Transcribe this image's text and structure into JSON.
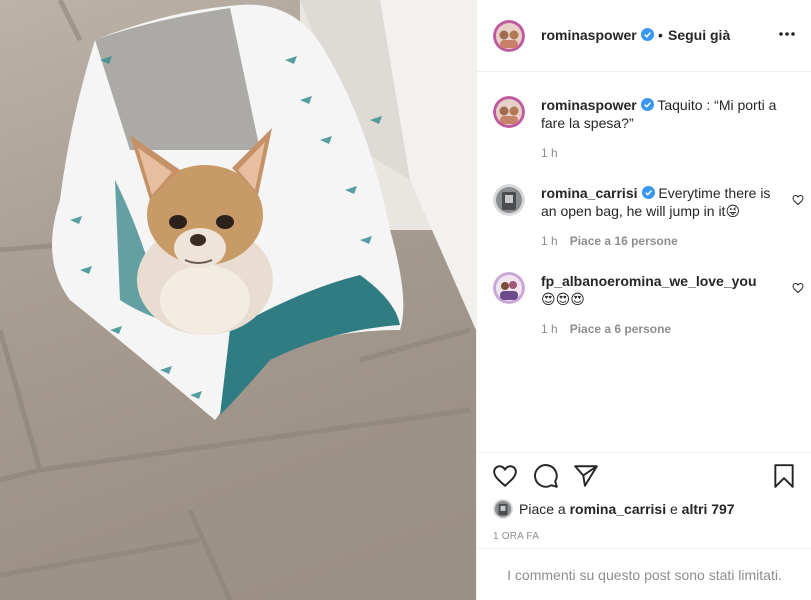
{
  "post": {
    "author": "rominaspower",
    "follow_label": "Segui già",
    "follow_separator": "•",
    "caption_author": "rominaspower",
    "caption_text": "Taquito : “Mi porti a fare la spesa?”",
    "caption_time": "1 h"
  },
  "comments": [
    {
      "username": "romina_carrisi",
      "verified": true,
      "text": "Everytime there is an open bag, he will jump in it😜",
      "time": "1 h",
      "likes": "Piace a 16 persone"
    },
    {
      "username": "fp_albanoeromina_we_love_you",
      "verified": false,
      "text": "😍😍😍",
      "time": "1 h",
      "likes": "Piace a 6 persone"
    }
  ],
  "likes_line": {
    "prefix": "Piace a",
    "user": "romina_carrisi",
    "connector": "e",
    "others": "altri 797"
  },
  "timestamp": "1 ORA FA",
  "comments_limited": "I commenti su questo post sono stati limitati.",
  "colors": {
    "verified": "#3897f0",
    "text": "#262626",
    "muted": "#8e8e8e",
    "divider": "#efefef"
  },
  "icons": {
    "more": "more-horizontal-icon",
    "like": "heart-icon",
    "comment": "comment-icon",
    "share": "paper-plane-icon",
    "save": "bookmark-icon",
    "verified": "verified-badge-icon"
  }
}
